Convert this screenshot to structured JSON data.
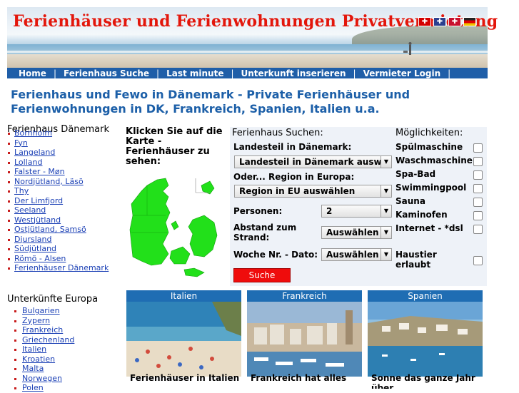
{
  "header": {
    "title": "Ferienhäuser und Ferienwohnungen Privatvermietung",
    "flags": [
      "ch-flag-icon",
      "uk-flag-icon",
      "dk-flag-icon",
      "de-flag-icon"
    ]
  },
  "nav": {
    "items": [
      "Home",
      "Ferienhaus Suche",
      "Last minute",
      "Unterkunft inserieren",
      "Vermieter Login"
    ],
    "separator": "|"
  },
  "page_heading": "Ferienhaus und Fewo in Dänemark - Private Ferienhäuser und Ferienwohnungen in DK, Frankreich, Spanien, Italien u.a.",
  "sidebar": {
    "denmark_title": "Ferienhaus Dänemark",
    "denmark_links": [
      "Bornholm",
      "Fyn",
      "Langeland",
      "Lolland",
      "Falster - Møn",
      "Nordjütland, Läsö",
      "Thy",
      "Der Limfjord",
      "Seeland",
      "Westjütland",
      "Ostjütland, Samsö",
      "Djursland",
      "Südjütland",
      "Römö - Alsen",
      "Ferienhäuser Dänemark"
    ],
    "europe_title": "Unterkünfte Europa",
    "europe_links": [
      "Bulgarien",
      "Zypern",
      "Frankreich",
      "Griechenland",
      "Italien",
      "Kroatien",
      "Malta",
      "Norwegen",
      "Polen"
    ]
  },
  "map": {
    "label": "Klicken Sie auf die Karte - Ferienhäuser zu sehen:"
  },
  "search": {
    "title": "Ferienhaus Suchen:",
    "region_label": "Landesteil in Dänemark:",
    "region_value": "Landesteil in Dänemark ausw",
    "eu_label": "Oder... Region in Europa:",
    "eu_value": "Region in EU auswählen",
    "persons_label": "Personen:",
    "persons_value": "2",
    "beach_label": "Abstand zum Strand:",
    "beach_value": "Auswählen",
    "week_label": "Woche Nr. - Dato:",
    "week_value": "Auswählen",
    "submit_label": "Suche",
    "options_title": "Möglichkeiten:",
    "options": [
      "Spülmaschine",
      "Waschmaschine",
      "Spa-Bad",
      "Swimmingpool",
      "Sauna",
      "Kaminofen",
      "Internet - *dsl",
      "Haustier erlaubt"
    ]
  },
  "cards": [
    {
      "country": "Italien",
      "caption": "Ferienhäuser in Italien"
    },
    {
      "country": "Frankreich",
      "caption": "Frankreich hat alles"
    },
    {
      "country": "Spanien",
      "caption": "Sonne das ganze Jahr über"
    }
  ],
  "colors": {
    "title_red": "#e3160b",
    "nav_blue": "#1f5ea8",
    "heading_blue": "#1c5fa8",
    "map_green": "#22e01a",
    "search_button": "#ef0c0c"
  }
}
